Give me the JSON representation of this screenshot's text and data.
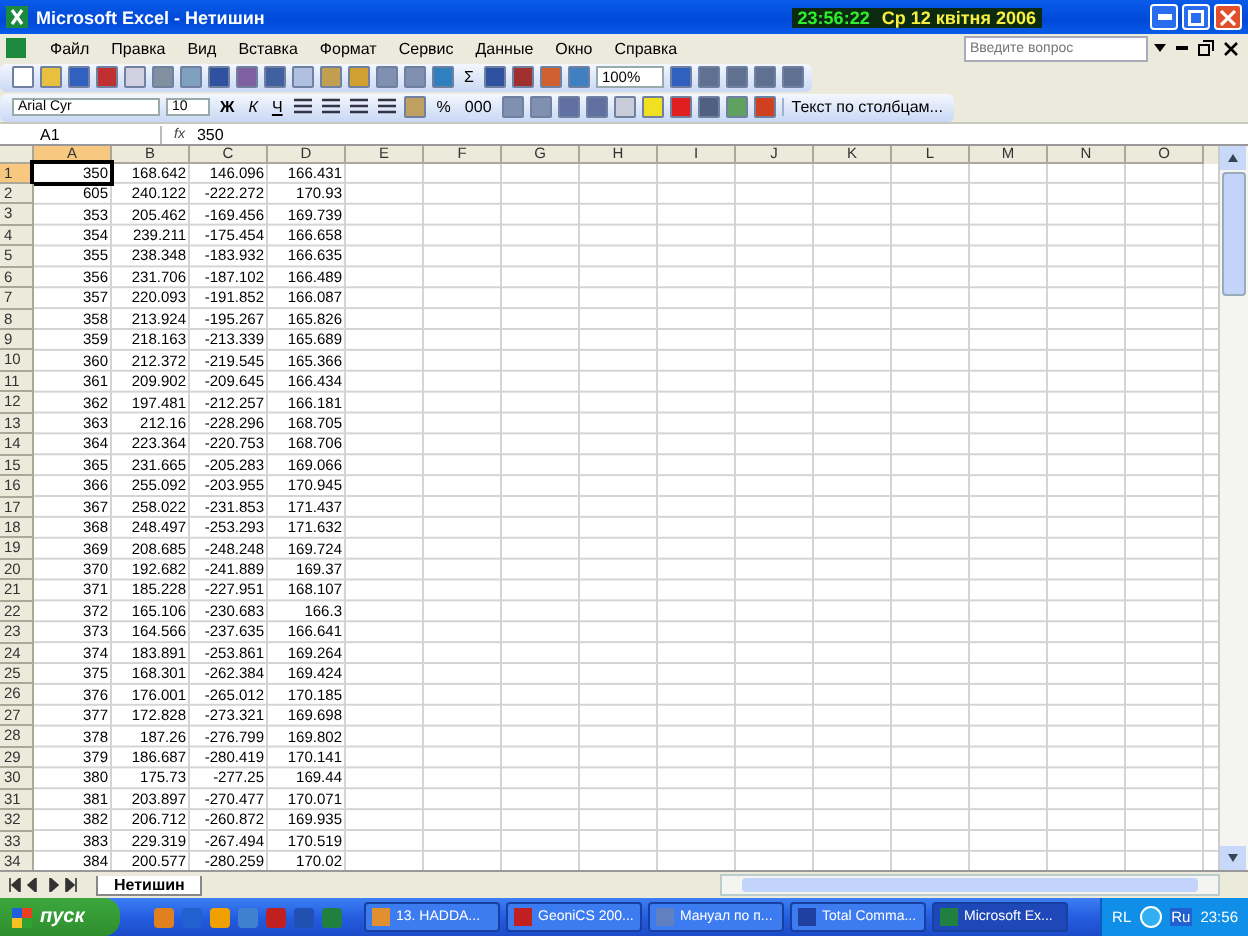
{
  "window": {
    "title": "Microsoft Excel - Нетишин",
    "clock_time": "23:56:22",
    "clock_date": "Ср 12 квітня 2006"
  },
  "menu": [
    "Файл",
    "Правка",
    "Вид",
    "Вставка",
    "Формат",
    "Сервис",
    "Данные",
    "Окно",
    "Справка"
  ],
  "help_search": {
    "placeholder": "Введите вопрос"
  },
  "standard_toolbar": {
    "autosum": "Σ",
    "zoom": "100%"
  },
  "formatting_toolbar": {
    "font": "Arial Cyr",
    "size": "10",
    "bold": "Ж",
    "italic": "К",
    "underline": "Ч",
    "percent": "%",
    "thousands": "000",
    "text_to_columns": "Текст по столбцам..."
  },
  "formula_bar": {
    "name_box": "A1",
    "fx": "fx",
    "value": "350"
  },
  "sheet": {
    "columns": [
      {
        "label": "A",
        "selected": true
      },
      {
        "label": "B",
        "selected": false
      },
      {
        "label": "C",
        "selected": false
      },
      {
        "label": "D",
        "selected": false
      },
      {
        "label": "E",
        "selected": false
      },
      {
        "label": "F",
        "selected": false
      },
      {
        "label": "G",
        "selected": false
      },
      {
        "label": "H",
        "selected": false
      },
      {
        "label": "I",
        "selected": false
      },
      {
        "label": "J",
        "selected": false
      },
      {
        "label": "K",
        "selected": false
      },
      {
        "label": "L",
        "selected": false
      },
      {
        "label": "M",
        "selected": false
      },
      {
        "label": "N",
        "selected": false
      },
      {
        "label": "O",
        "selected": false
      }
    ],
    "rows": [
      {
        "label": "1",
        "selected": true,
        "cells": [
          "350",
          "168.642",
          "146.096",
          "166.431"
        ]
      },
      {
        "label": "2",
        "selected": false,
        "cells": [
          "605",
          "240.122",
          "-222.272",
          "170.93"
        ]
      },
      {
        "label": "3",
        "selected": false,
        "cells": [
          "353",
          "205.462",
          "-169.456",
          "169.739"
        ]
      },
      {
        "label": "4",
        "selected": false,
        "cells": [
          "354",
          "239.211",
          "-175.454",
          "166.658"
        ]
      },
      {
        "label": "5",
        "selected": false,
        "cells": [
          "355",
          "238.348",
          "-183.932",
          "166.635"
        ]
      },
      {
        "label": "6",
        "selected": false,
        "cells": [
          "356",
          "231.706",
          "-187.102",
          "166.489"
        ]
      },
      {
        "label": "7",
        "selected": false,
        "cells": [
          "357",
          "220.093",
          "-191.852",
          "166.087"
        ]
      },
      {
        "label": "8",
        "selected": false,
        "cells": [
          "358",
          "213.924",
          "-195.267",
          "165.826"
        ]
      },
      {
        "label": "9",
        "selected": false,
        "cells": [
          "359",
          "218.163",
          "-213.339",
          "165.689"
        ]
      },
      {
        "label": "10",
        "selected": false,
        "cells": [
          "360",
          "212.372",
          "-219.545",
          "165.366"
        ]
      },
      {
        "label": "11",
        "selected": false,
        "cells": [
          "361",
          "209.902",
          "-209.645",
          "166.434"
        ]
      },
      {
        "label": "12",
        "selected": false,
        "cells": [
          "362",
          "197.481",
          "-212.257",
          "166.181"
        ]
      },
      {
        "label": "13",
        "selected": false,
        "cells": [
          "363",
          "212.16",
          "-228.296",
          "168.705"
        ]
      },
      {
        "label": "14",
        "selected": false,
        "cells": [
          "364",
          "223.364",
          "-220.753",
          "168.706"
        ]
      },
      {
        "label": "15",
        "selected": false,
        "cells": [
          "365",
          "231.665",
          "-205.283",
          "169.066"
        ]
      },
      {
        "label": "16",
        "selected": false,
        "cells": [
          "366",
          "255.092",
          "-203.955",
          "170.945"
        ]
      },
      {
        "label": "17",
        "selected": false,
        "cells": [
          "367",
          "258.022",
          "-231.853",
          "171.437"
        ]
      },
      {
        "label": "18",
        "selected": false,
        "cells": [
          "368",
          "248.497",
          "-253.293",
          "171.632"
        ]
      },
      {
        "label": "19",
        "selected": false,
        "cells": [
          "369",
          "208.685",
          "-248.248",
          "169.724"
        ]
      },
      {
        "label": "20",
        "selected": false,
        "cells": [
          "370",
          "192.682",
          "-241.889",
          "169.37"
        ]
      },
      {
        "label": "21",
        "selected": false,
        "cells": [
          "371",
          "185.228",
          "-227.951",
          "168.107"
        ]
      },
      {
        "label": "22",
        "selected": false,
        "cells": [
          "372",
          "165.106",
          "-230.683",
          "166.3"
        ]
      },
      {
        "label": "23",
        "selected": false,
        "cells": [
          "373",
          "164.566",
          "-237.635",
          "166.641"
        ]
      },
      {
        "label": "24",
        "selected": false,
        "cells": [
          "374",
          "183.891",
          "-253.861",
          "169.264"
        ]
      },
      {
        "label": "25",
        "selected": false,
        "cells": [
          "375",
          "168.301",
          "-262.384",
          "169.424"
        ]
      },
      {
        "label": "26",
        "selected": false,
        "cells": [
          "376",
          "176.001",
          "-265.012",
          "170.185"
        ]
      },
      {
        "label": "27",
        "selected": false,
        "cells": [
          "377",
          "172.828",
          "-273.321",
          "169.698"
        ]
      },
      {
        "label": "28",
        "selected": false,
        "cells": [
          "378",
          "187.26",
          "-276.799",
          "169.802"
        ]
      },
      {
        "label": "29",
        "selected": false,
        "cells": [
          "379",
          "186.687",
          "-280.419",
          "170.141"
        ]
      },
      {
        "label": "30",
        "selected": false,
        "cells": [
          "380",
          "175.73",
          "-277.25",
          "169.44"
        ]
      },
      {
        "label": "31",
        "selected": false,
        "cells": [
          "381",
          "203.897",
          "-270.477",
          "170.071"
        ]
      },
      {
        "label": "32",
        "selected": false,
        "cells": [
          "382",
          "206.712",
          "-260.872",
          "169.935"
        ]
      },
      {
        "label": "33",
        "selected": false,
        "cells": [
          "383",
          "229.319",
          "-267.494",
          "170.519"
        ]
      },
      {
        "label": "34",
        "selected": false,
        "cells": [
          "384",
          "200.577",
          "-280.259",
          "170.02"
        ]
      }
    ]
  },
  "sheet_tabs": [
    {
      "label": "Нетишин",
      "selected": true
    }
  ],
  "taskbar": {
    "start": "пуск",
    "tasks": [
      {
        "label": "13. HADDA...",
        "selected": false
      },
      {
        "label": "GeoniCS 200...",
        "selected": false
      },
      {
        "label": "Мануал по п...",
        "selected": false
      },
      {
        "label": "Total Comma...",
        "selected": false
      },
      {
        "label": "Microsoft Ex...",
        "selected": true
      }
    ],
    "language": "RL",
    "tray_language": "Ru",
    "time": "23:56"
  }
}
